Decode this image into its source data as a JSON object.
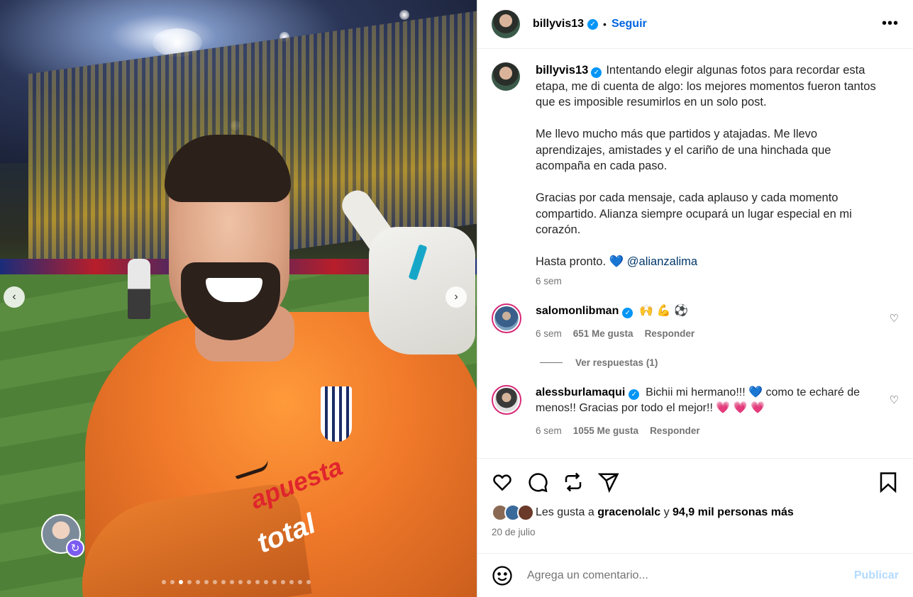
{
  "header": {
    "username": "billyvis13",
    "separator": "•",
    "follow_label": "Seguir",
    "more_label": "•••"
  },
  "caption": {
    "username": "billyvis13",
    "paragraph1": "Intentando elegir algunas fotos para recordar esta etapa, me di cuenta de algo: los mejores momentos fueron tantos que es imposible resumirlos en un solo post.",
    "paragraph2": "Me llevo mucho más que partidos y atajadas. Me llevo aprendizajes, amistades y el cariño de una hinchada que acompaña en cada paso.",
    "paragraph3": "Gracias por cada mensaje, cada aplauso y cada momento compartido. Alianza siempre ocupará un lugar especial en mi corazón.",
    "paragraph4": "Hasta pronto.",
    "heart": "💙",
    "mention": "@alianzalima",
    "time": "6 sem"
  },
  "comments": [
    {
      "username": "salomonlibman",
      "text": "🙌 💪 ⚽",
      "time": "6 sem",
      "likes": "651 Me gusta",
      "reply": "Responder",
      "view_replies": "Ver respuestas (1)"
    },
    {
      "username": "alessburlamaqui",
      "text": "Bichii mi hermano!!! 💙 como te echaré de menos!! Gracias por todo el mejor!! 💗 💗 💗",
      "time": "6 sem",
      "likes": "1055 Me gusta",
      "reply": "Responder"
    }
  ],
  "likes": {
    "prefix": "Les gusta a",
    "user": "gracenolalc",
    "connector": "y",
    "others": "94,9 mil personas más"
  },
  "date": "20 de julio",
  "add_comment": {
    "placeholder": "Agrega un comentario...",
    "publish_label": "Publicar"
  },
  "photo": {
    "sponsor_red": "apuesta",
    "sponsor_white": "total",
    "prev": "‹",
    "next": "›",
    "carousel_count": 18,
    "carousel_active_index": 2
  },
  "colors": {
    "link_blue": "#0064e0",
    "verified_blue": "#0095f6",
    "publish_disabled": "#b3dbff",
    "jersey_orange": "#f0792a"
  },
  "icons": {
    "like": "heart-outline-icon",
    "comment": "speech-bubble-icon",
    "repost": "repost-icon",
    "share": "paper-plane-icon",
    "save": "bookmark-icon",
    "emoji": "smiley-icon",
    "verified": "verified-badge-icon"
  }
}
